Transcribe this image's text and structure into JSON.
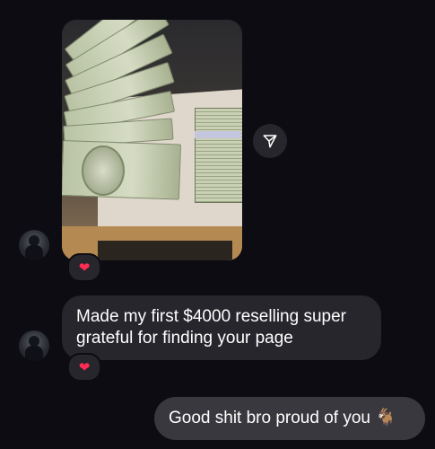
{
  "thread": {
    "messages": [
      {
        "type": "image",
        "from": "other",
        "reaction": "❤"
      },
      {
        "type": "text",
        "from": "other",
        "text": "Made my first $4000 reselling super grateful for finding your page",
        "reaction": "❤"
      },
      {
        "type": "text",
        "from": "me",
        "text": "Good shit bro proud of you",
        "emoji": "🐐"
      }
    ]
  },
  "colors": {
    "background": "#0c0c12",
    "incoming_bubble": "#26262c",
    "outgoing_bubble": "#38383e",
    "heart": "#ff2d55"
  },
  "icons": {
    "share": "paper-plane-icon",
    "reaction": "heart-icon"
  }
}
